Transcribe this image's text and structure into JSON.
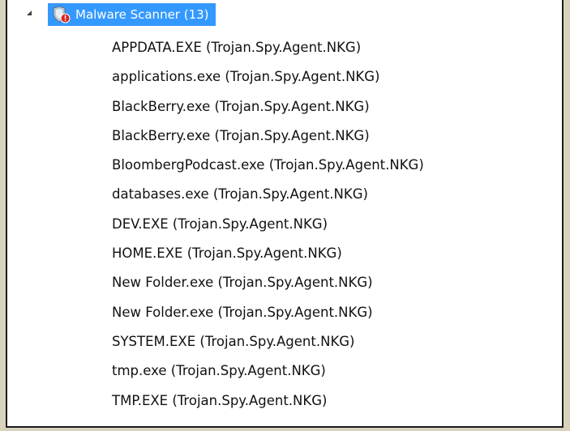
{
  "tree": {
    "root": {
      "label": "Malware Scanner (13)",
      "icon": "scanner-shield-warning-icon",
      "expanded": true,
      "selected": true,
      "selection_color": "#3399ff"
    },
    "items": [
      {
        "label": "APPDATA.EXE (Trojan.Spy.Agent.NKG)"
      },
      {
        "label": "applications.exe (Trojan.Spy.Agent.NKG)"
      },
      {
        "label": "BlackBerry.exe (Trojan.Spy.Agent.NKG)"
      },
      {
        "label": "BlackBerry.exe (Trojan.Spy.Agent.NKG)"
      },
      {
        "label": "BloombergPodcast.exe (Trojan.Spy.Agent.NKG)"
      },
      {
        "label": "databases.exe (Trojan.Spy.Agent.NKG)"
      },
      {
        "label": "DEV.EXE (Trojan.Spy.Agent.NKG)"
      },
      {
        "label": "HOME.EXE (Trojan.Spy.Agent.NKG)"
      },
      {
        "label": "New Folder.exe (Trojan.Spy.Agent.NKG)"
      },
      {
        "label": "New Folder.exe (Trojan.Spy.Agent.NKG)"
      },
      {
        "label": "SYSTEM.EXE (Trojan.Spy.Agent.NKG)"
      },
      {
        "label": "tmp.exe (Trojan.Spy.Agent.NKG)"
      },
      {
        "label": "TMP.EXE (Trojan.Spy.Agent.NKG)"
      }
    ]
  }
}
